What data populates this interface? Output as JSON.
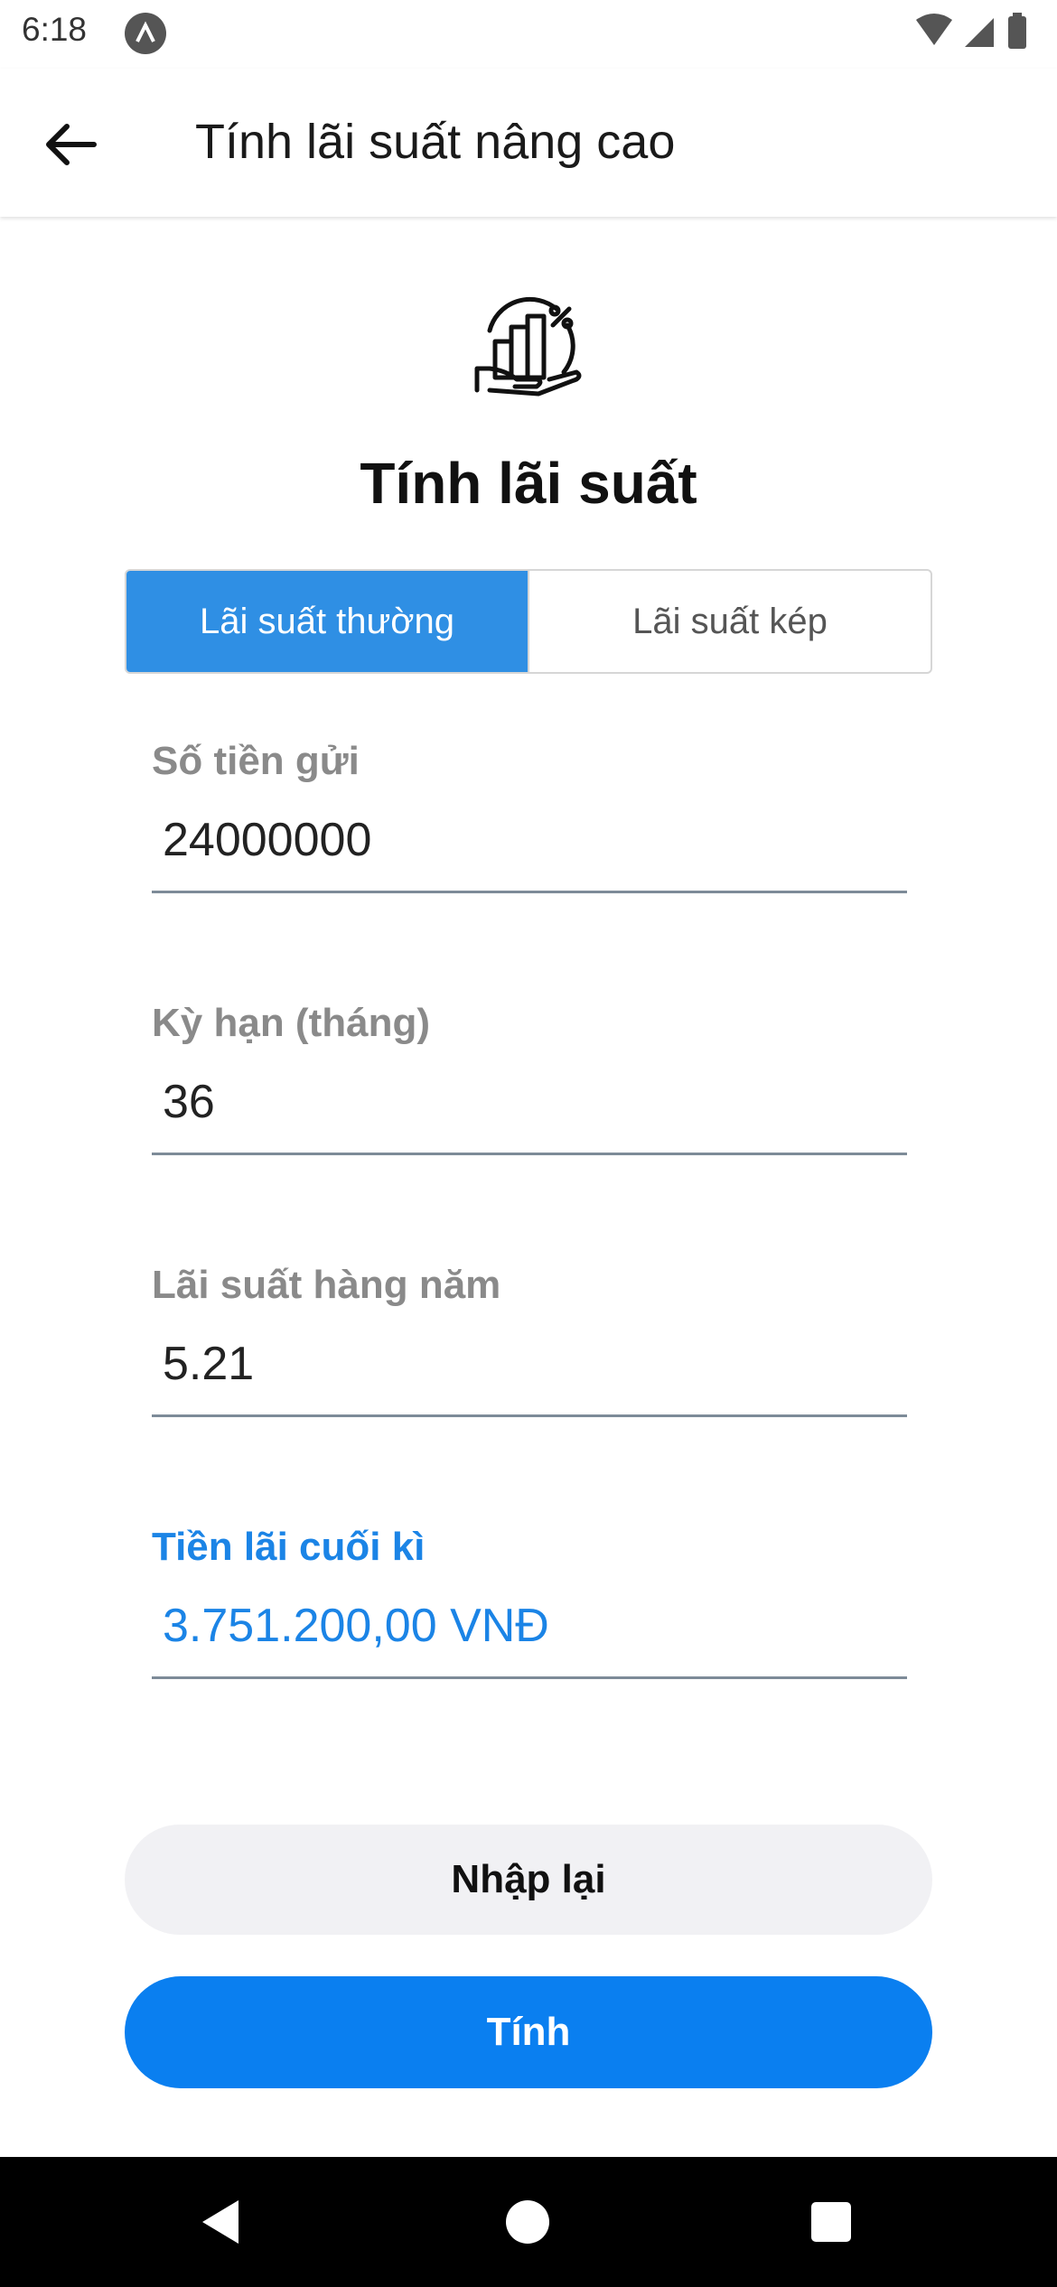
{
  "status_bar": {
    "time": "6:18",
    "icons": [
      "app-notification-icon",
      "wifi-icon",
      "signal-icon",
      "battery-icon"
    ]
  },
  "app_bar": {
    "title": "Tính lãi suất nâng cao",
    "back_icon": "arrow-left-icon"
  },
  "hero": {
    "icon": "interest-chart-hand-icon",
    "title": "Tính lãi suất"
  },
  "tabs": [
    {
      "label": "Lãi suất thường",
      "active": true
    },
    {
      "label": "Lãi suất kép",
      "active": false
    }
  ],
  "fields": {
    "deposit": {
      "label": "Số tiền gửi",
      "value": "24000000"
    },
    "term": {
      "label": "Kỳ hạn (tháng)",
      "value": "36"
    },
    "rate": {
      "label": "Lãi suất hàng năm",
      "value": "5.21"
    },
    "result": {
      "label": "Tiền lãi cuối kì",
      "value": "3.751.200,00 VNĐ"
    }
  },
  "buttons": {
    "reset": "Nhập lại",
    "calculate": "Tính"
  },
  "colors": {
    "accent": "#0a7ff0",
    "tab_active": "#2f8fe4",
    "result_text": "#1b84e6",
    "reset_bg": "#f1f1f4"
  }
}
